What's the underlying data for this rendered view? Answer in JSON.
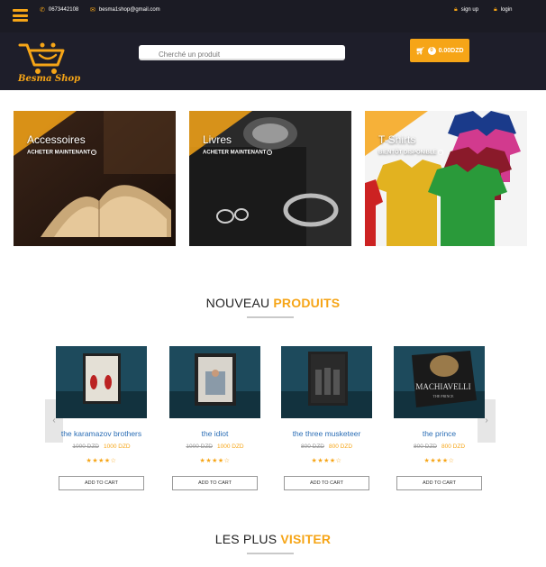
{
  "topbar": {
    "phone": "0673442108",
    "email": "besma1shop@gmail.com",
    "signup": "sign up",
    "login": "login"
  },
  "header": {
    "logo_text": "Besma Shop",
    "search_placeholder": "Cherché un produit",
    "cart_count": "0",
    "cart_total": "0.00DZD"
  },
  "categories": [
    {
      "title": "Accessoires",
      "cta": "ACHETER MAINTENANT"
    },
    {
      "title": "Livres",
      "cta": "ACHETER MAINTENANT"
    },
    {
      "title": "T-Shirts",
      "cta": "BIENTÔT DISPONIBLE"
    }
  ],
  "new_products": {
    "title_plain": "NOUVEAU",
    "title_highlight": "PRODUITS",
    "items": [
      {
        "name": "the karamazov brothers",
        "old_price": "1000 DZD",
        "price": "1000 DZD",
        "rating": 4,
        "button": "ADD TO CART"
      },
      {
        "name": "the idiot",
        "old_price": "1000 DZD",
        "price": "1000 DZD",
        "rating": 4,
        "button": "ADD TO CART"
      },
      {
        "name": "the three musketeer",
        "old_price": "800 DZD",
        "price": "800 DZD",
        "rating": 4,
        "button": "ADD TO CART"
      },
      {
        "name": "the prince",
        "old_price": "800 DZD",
        "price": "800 DZD",
        "rating": 4,
        "button": "ADD TO CART"
      }
    ]
  },
  "most_visited": {
    "title_plain": "LES PLUS",
    "title_highlight": "VISITER"
  },
  "colors": {
    "accent": "#f6a517",
    "dark": "#1e1e2a",
    "link": "#2a6db5"
  }
}
